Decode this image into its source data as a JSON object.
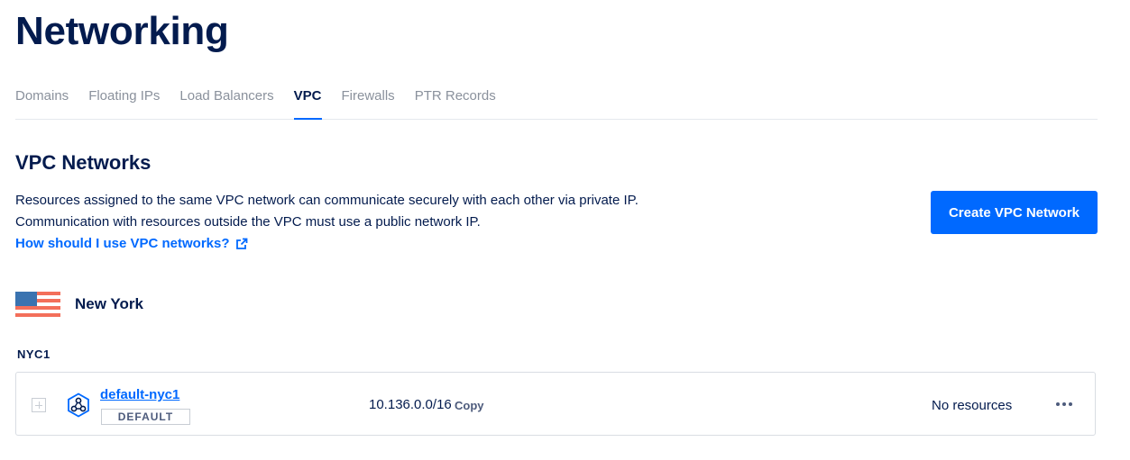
{
  "page": {
    "title": "Networking"
  },
  "tabs": [
    {
      "label": "Domains",
      "active": false
    },
    {
      "label": "Floating IPs",
      "active": false
    },
    {
      "label": "Load Balancers",
      "active": false
    },
    {
      "label": "VPC",
      "active": true
    },
    {
      "label": "Firewalls",
      "active": false
    },
    {
      "label": "PTR Records",
      "active": false
    }
  ],
  "section": {
    "title": "VPC Networks",
    "description_line1": "Resources assigned to the same VPC network can communicate securely with each other via private IP.",
    "description_line2": "Communication with resources outside the VPC must use a public network IP.",
    "help_link": "How should I use VPC networks?",
    "create_button": "Create VPC Network"
  },
  "region": {
    "name": "New York",
    "flag_icon": "us-flag-icon",
    "datacenter": "NYC1"
  },
  "vpc": {
    "name": "default-nyc1",
    "badge": "DEFAULT",
    "ip_range": "10.136.0.0/16",
    "copy_label": "Copy",
    "resources": "No resources",
    "icon": "vpc-network-icon"
  },
  "colors": {
    "primary": "#0069ff",
    "text": "#031b4e",
    "muted": "#8a919c",
    "flag_blue": "#3a73b0",
    "flag_red": "#f36f5a"
  }
}
